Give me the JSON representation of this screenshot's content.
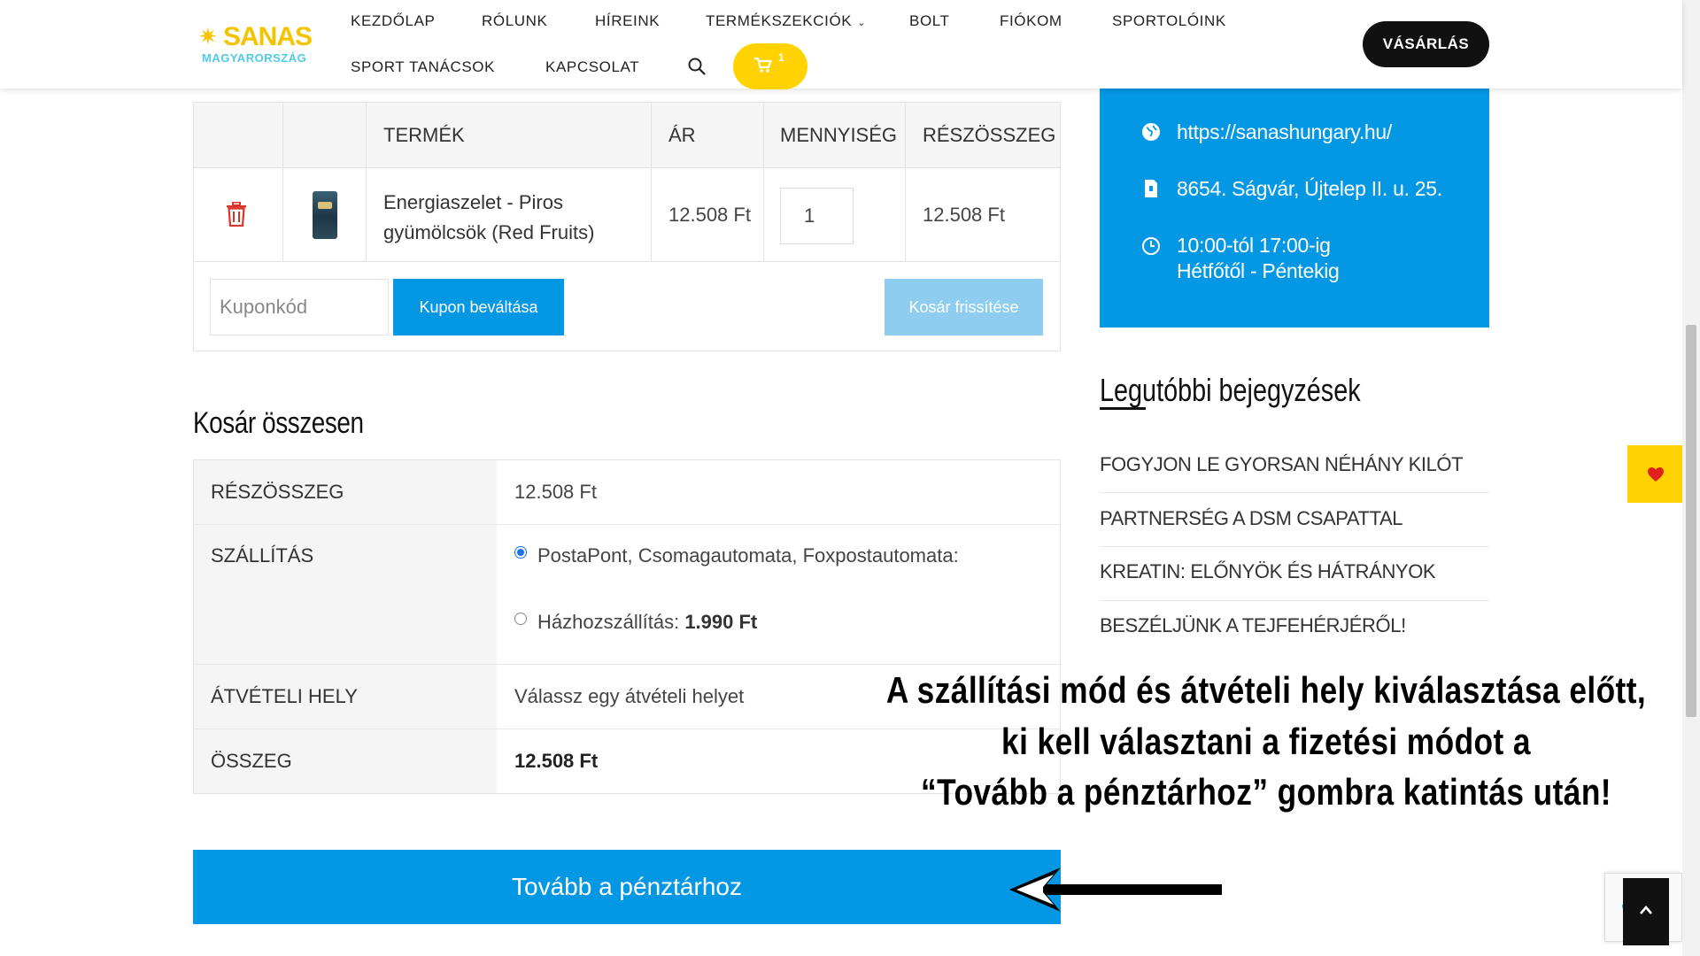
{
  "logo": {
    "name": "SANAS",
    "sub": "MAGYARORSZÁG"
  },
  "nav": {
    "row1": [
      "KEZDŐLAP",
      "RÓLUNK",
      "HÍREINK",
      "TERMÉKSZEKCIÓK",
      "BOLT",
      "FIÓKOM",
      "SPORTOLÓINK"
    ],
    "row2": [
      "SPORT TANÁCSOK",
      "KAPCSOLAT"
    ],
    "cart_count": "1",
    "buy_label": "VÁSÁRLÁS"
  },
  "cart": {
    "headers": [
      "TERMÉK",
      "ÁR",
      "MENNYISÉG",
      "RÉSZÖSSZEG"
    ],
    "item": {
      "name": "Energiaszelet - Piros gyümölcsök (Red Fruits)",
      "price": "12.508 Ft",
      "qty": "1",
      "subtotal": "12.508 Ft"
    },
    "coupon_placeholder": "Kuponkód",
    "apply_coupon": "Kupon beváltása",
    "update_cart": "Kosár frissítése"
  },
  "totals": {
    "title": "Kosár összesen",
    "subtotal_label": "RÉSZÖSSZEG",
    "subtotal_value": "12.508 Ft",
    "shipping_label": "SZÁLLÍTÁS",
    "shipping_option1": "PostaPont, Csomagautomata, Foxpostautomata:",
    "shipping_option2_label": "Házhozszállítás:",
    "shipping_option2_price": "1.990 Ft",
    "pickup_label": "ÁTVÉTELI HELY",
    "pickup_value": "Válassz egy átvételi helyet",
    "total_label": "ÖSSZEG",
    "total_value": "12.508 Ft",
    "checkout": "Tovább a pénztárhoz"
  },
  "contact": {
    "url": "https://sanashungary.hu/",
    "address": "8654. Ságvár, Újtelep II. u. 25.",
    "hours": "10:00-tól 17:00-ig",
    "days": "Hétfőtől - Péntekig"
  },
  "recent": {
    "title": "Legutóbbi bejegyzések",
    "posts": [
      "FOGYJON LE GYORSAN NÉHÁNY KILÓT",
      "PARTNERSÉG A DSM CSAPATTAL",
      "KREATIN: ELŐNYÖK ÉS HÁTRÁNYOK",
      "BESZÉLJÜNK A TEJFEHÉRJÉRŐL!"
    ]
  },
  "annotation": {
    "line1": "A szállítási mód és átvételi hely kiválasztása előtt,",
    "line2": "ki kell választani a fizetési módot a",
    "line3": "“Tovább a pénztárhoz” gombra katintás után!"
  },
  "colors": {
    "accent": "#0497e4",
    "yellow": "#ffd200",
    "dark": "#111111"
  }
}
